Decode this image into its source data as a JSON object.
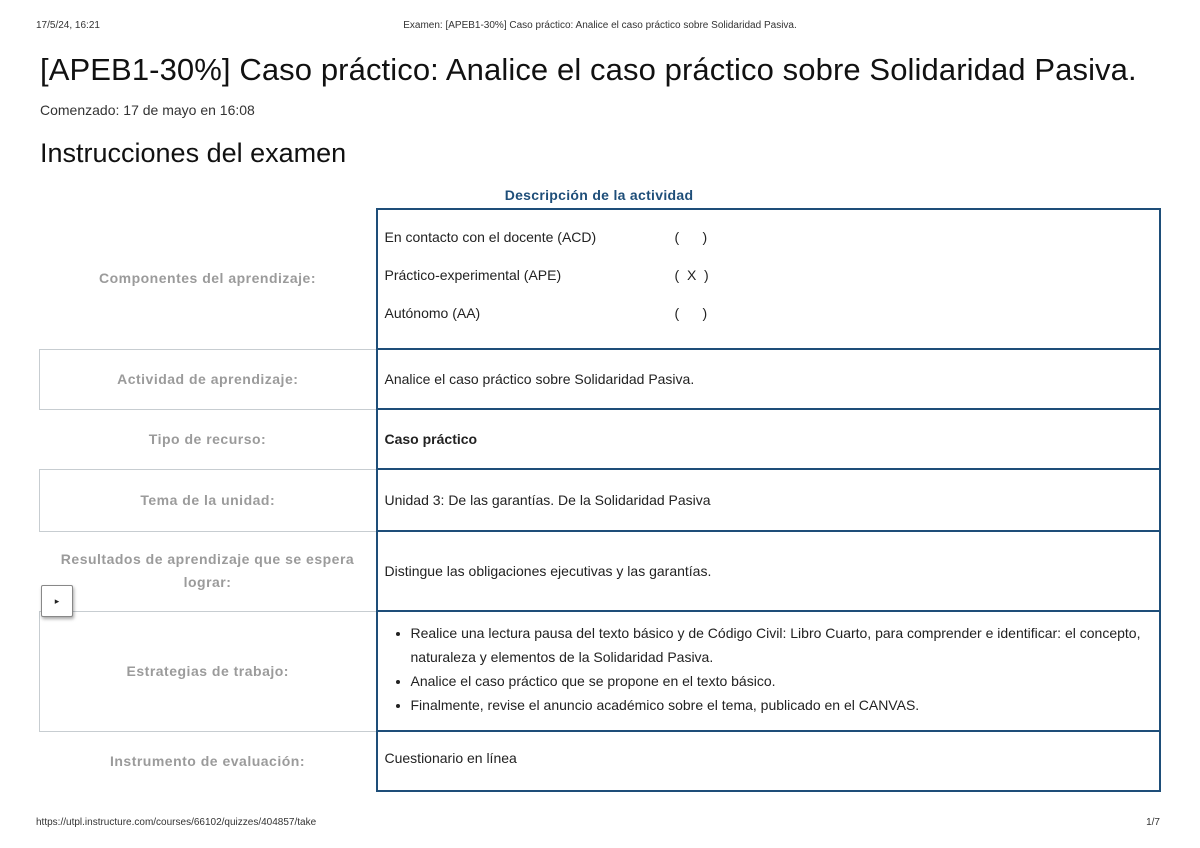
{
  "print_header": {
    "date": "17/5/24, 16:21",
    "title": "Examen: [APEB1-30%] Caso práctico: Analice el caso práctico sobre Solidaridad Pasiva."
  },
  "page": {
    "title": "[APEB1-30%] Caso práctico: Analice el caso práctico sobre Solidaridad Pasiva.",
    "started_label": "Comenzado:",
    "started_value": "17 de mayo en 16:08",
    "instructions_title": "Instrucciones del examen"
  },
  "activity_table": {
    "caption": "Descripción de la actividad",
    "components": {
      "label": "Componentes del aprendizaje:",
      "items": [
        {
          "name": "En contacto con el docente (ACD)",
          "mark": "(      )"
        },
        {
          "name": "Práctico-experimental (APE)",
          "mark": "(  X  )"
        },
        {
          "name": "Autónomo (AA)",
          "mark": "(      )"
        }
      ]
    },
    "activity": {
      "label": "Actividad de aprendizaje:",
      "value": "Analice el caso práctico sobre Solidaridad Pasiva."
    },
    "resource": {
      "label": "Tipo de recurso:",
      "value": "Caso práctico"
    },
    "unit": {
      "label": "Tema de la unidad:",
      "value": "Unidad 3: De las garantías. De la Solidaridad Pasiva"
    },
    "results": {
      "label": "Resultados de aprendizaje que se espera lograr:",
      "value": "Distingue las obligaciones ejecutivas y las garantías."
    },
    "strategies": {
      "label": "Estrategias de trabajo:",
      "items": [
        "Realice una lectura pausa del texto básico y de Código Civil: Libro Cuarto, para comprender e identificar: el concepto, naturaleza y elementos de la Solidaridad Pasiva.",
        "Analice el caso práctico que se propone en el texto básico.",
        "Finalmente, revise el anuncio académico sobre el tema, publicado en el CANVAS."
      ]
    },
    "instrument": {
      "label": "Instrumento de evaluación:",
      "value": "Cuestionario en línea"
    }
  },
  "side_toggle": {
    "icon": "play-triangle-icon",
    "glyph": "▸"
  },
  "print_footer": {
    "url": "https://utpl.instructure.com/courses/66102/quizzes/404857/take",
    "page": "1/7"
  }
}
